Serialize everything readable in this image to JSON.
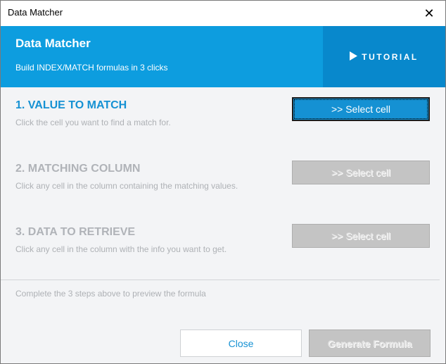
{
  "window": {
    "title": "Data Matcher",
    "close_glyph": "✕"
  },
  "banner": {
    "heading": "Data Matcher",
    "subtitle": "Build INDEX/MATCH formulas in 3 clicks",
    "tutorial_label": "TUTORIAL",
    "tutorial_icon": "play-icon",
    "colors": {
      "background": "#0d9ddf",
      "tutorial_background": "#0888cc"
    }
  },
  "steps": [
    {
      "title": "1. VALUE TO MATCH",
      "description": "Click the cell you want to find a match for.",
      "button_label": ">> Select cell",
      "state": "active"
    },
    {
      "title": "2. MATCHING COLUMN",
      "description": "Click any cell in the column containing the matching values.",
      "button_label": ">> Select cell",
      "state": "disabled"
    },
    {
      "title": "3. DATA TO RETRIEVE",
      "description": "Click any cell in the column with the info you want to get.",
      "button_label": ">> Select cell",
      "state": "disabled"
    }
  ],
  "preview_text": "Complete the 3 steps above to preview the formula",
  "footer": {
    "close_label": "Close",
    "generate_label": "Generate Formula"
  },
  "colors": {
    "accent": "#1591d3",
    "disabled": "#c4c4c4"
  }
}
